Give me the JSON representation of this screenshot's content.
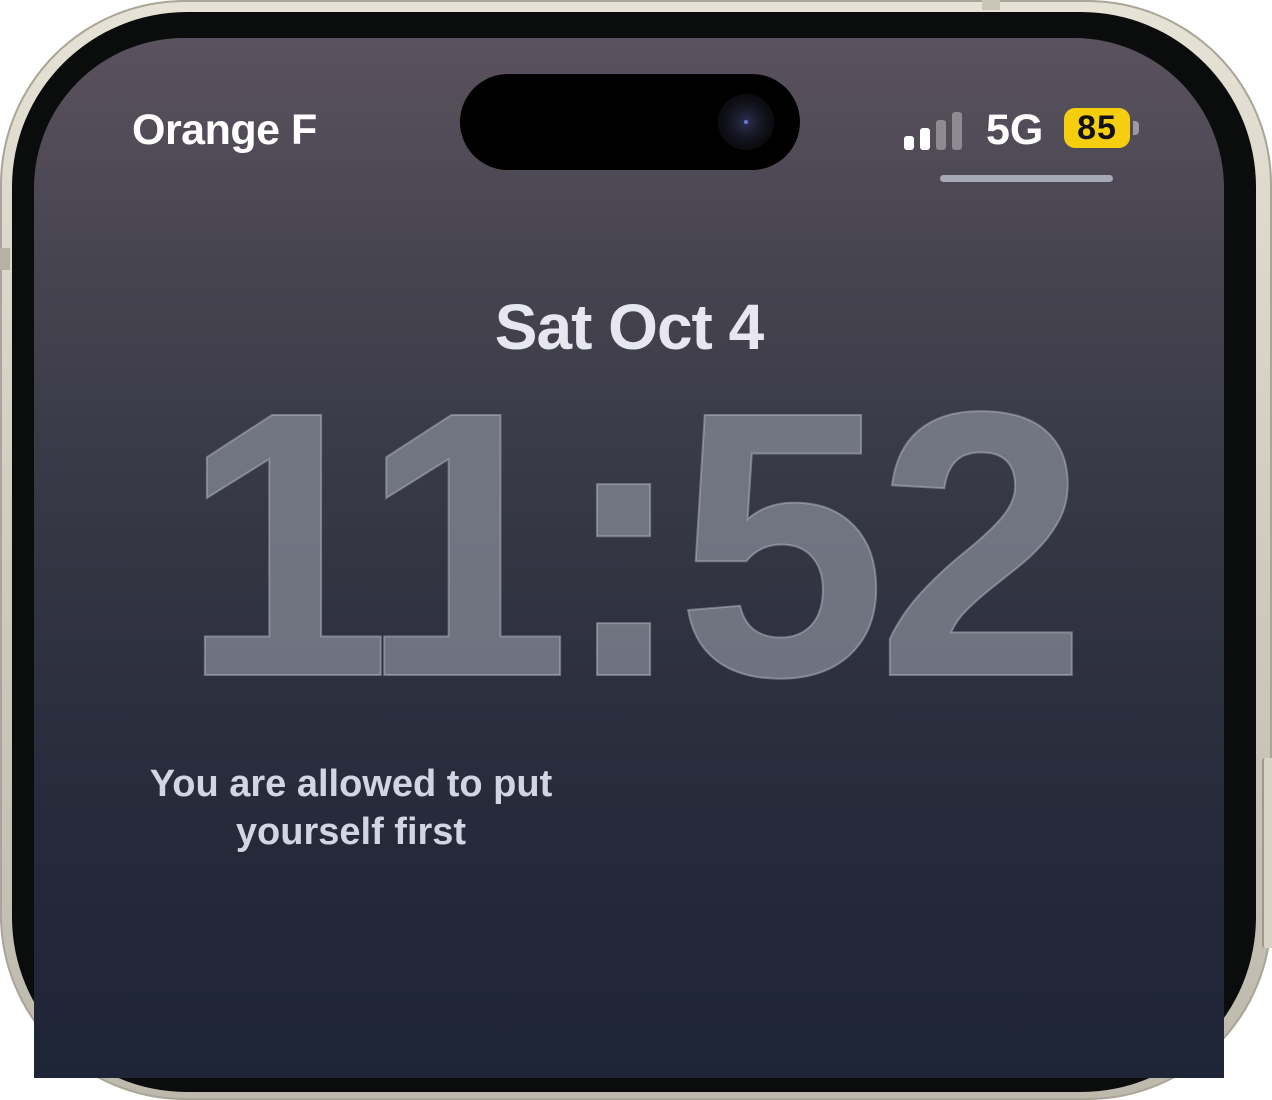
{
  "status_bar": {
    "carrier": "Orange F",
    "network_type": "5G",
    "signal_bars_active": 2,
    "signal_bars_total": 4,
    "battery_level": "85",
    "battery_color": "#f5cf0f"
  },
  "lock_screen": {
    "date": "Sat Oct 4",
    "time": "11:52",
    "widget_text": "You are allowed to put yourself first"
  },
  "icons": [
    "signal-icon",
    "battery-icon",
    "front-camera-icon"
  ]
}
